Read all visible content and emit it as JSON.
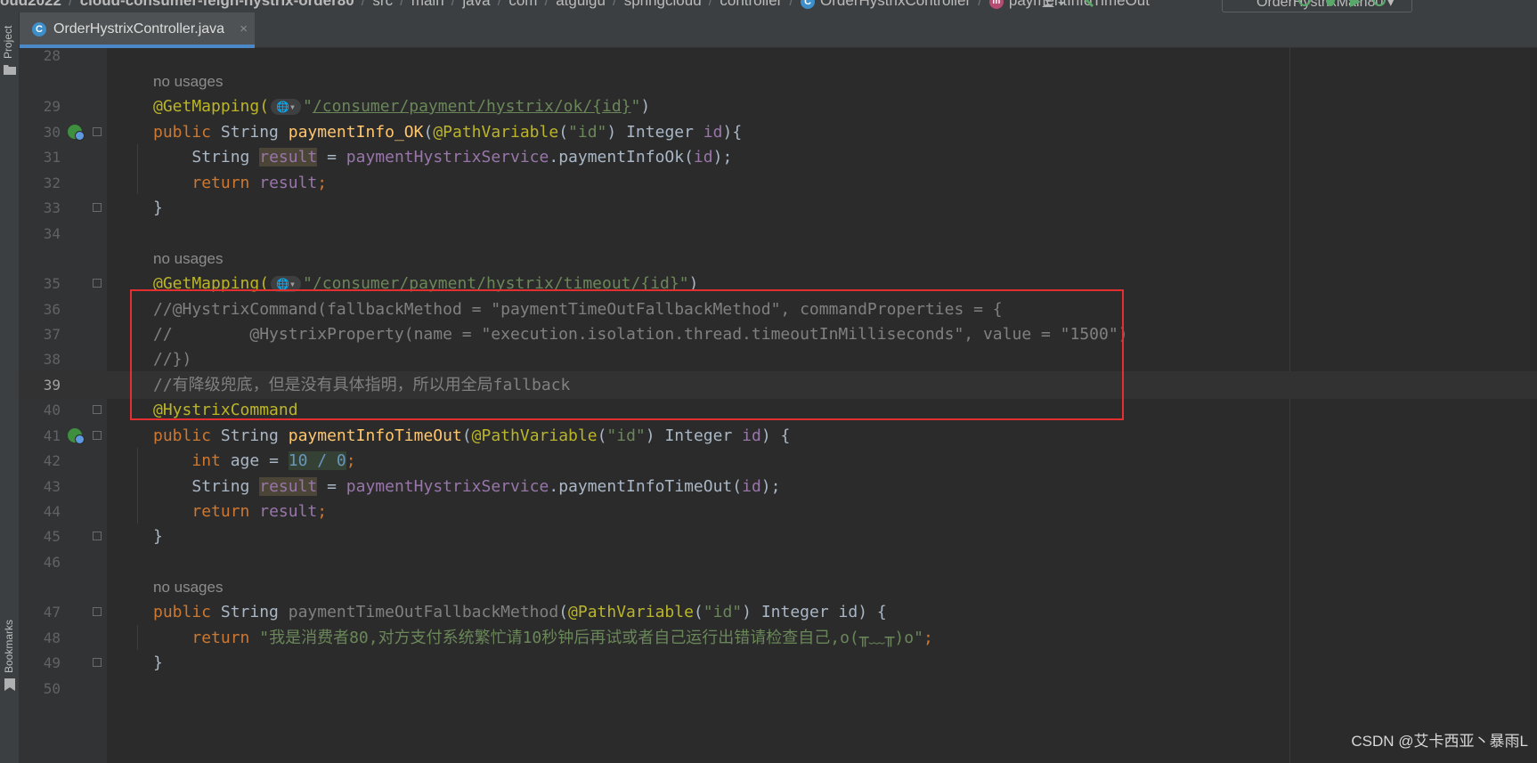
{
  "breadcrumbs": [
    "oud2022",
    "cloud-consumer-feign-hystrix-order80",
    "src",
    "main",
    "java",
    "com",
    "atguigu",
    "springcloud",
    "controller",
    "OrderHystrixController",
    "paymentInfoTimeOut"
  ],
  "breadcrumb_icons": {
    "class_letter": "C",
    "method_letter": "m"
  },
  "run_config": "OrderHystrixMain80",
  "tab": {
    "label": "OrderHystrixController.java",
    "icon_letter": "C",
    "close": "×"
  },
  "tool_windows": {
    "project": "Project",
    "bookmarks": "Bookmarks"
  },
  "code": {
    "hint_no_usages": "no usages",
    "line_numbers": [
      "28",
      "29",
      "30",
      "31",
      "32",
      "33",
      "34",
      "35",
      "36",
      "37",
      "38",
      "39",
      "40",
      "41",
      "42",
      "43",
      "44",
      "45",
      "46",
      "47",
      "48",
      "49",
      "50"
    ],
    "current_line": "39",
    "l29_ann": "@GetMapping(",
    "l29_url": "/consumer/payment/hystrix/ok/{id}",
    "l30": {
      "kw": "public",
      "type": "String",
      "method": "paymentInfo_OK",
      "ann": "@PathVariable",
      "str": "\"id\"",
      "type2": "Integer",
      "param": "id",
      "tail": "){"
    },
    "l31": {
      "type": "String",
      "var": "result",
      "service": "paymentHystrixService",
      "call": ".paymentInfoOk(",
      "arg": "id",
      "end": ");"
    },
    "l32": {
      "kw": "return",
      "var": "result",
      "end": ";"
    },
    "brace_close": "}",
    "l35_ann": "@GetMapping(",
    "l35_url": "/consumer/payment/hystrix/timeout/{id}",
    "l36": "//@HystrixCommand(fallbackMethod = \"paymentTimeOutFallbackMethod\", commandProperties = {",
    "l37": "//        @HystrixProperty(name = \"execution.isolation.thread.timeoutInMilliseconds\", value = \"1500\")",
    "l38": "//})",
    "l39": "//有降级兜底，但是没有具体指明，所以用全局fallback",
    "l40": "@HystrixCommand",
    "l41": {
      "kw": "public",
      "type": "String",
      "method": "paymentInfoTimeOut",
      "ann": "@PathVariable",
      "str": "\"id\"",
      "type2": "Integer",
      "param": "id",
      "tail": ") {"
    },
    "l42": {
      "kw": "int",
      "var": "age",
      "eq": " = ",
      "expr": "10 / 0",
      "end": ";"
    },
    "l43": {
      "type": "String",
      "var": "result",
      "service": "paymentHystrixService",
      "call": ".paymentInfoTimeOut(",
      "arg": "id",
      "end": ");"
    },
    "l44": {
      "kw": "return",
      "var": "result",
      "end": ";"
    },
    "l47": {
      "kw": "public",
      "type": "String",
      "method": "paymentTimeOutFallbackMethod",
      "ann": "@PathVariable",
      "str": "\"id\"",
      "type2": "Integer",
      "param": "id",
      "tail": ") {"
    },
    "l48": {
      "kw": "return",
      "str": "\"我是消费者80,对方支付系统繁忙请10秒钟后再试或者自己运行出错请检查自己,o(╥﹏╥)o\"",
      "end": ";"
    }
  },
  "watermark": "CSDN @艾卡西亚丶暴雨L",
  "colors": {
    "keyword": "#cc7832",
    "annotation": "#bbb529",
    "string": "#6a8759",
    "comment": "#808080",
    "field": "#9876aa",
    "method": "#ffc66d",
    "highlight_box": "#e32f2f"
  }
}
